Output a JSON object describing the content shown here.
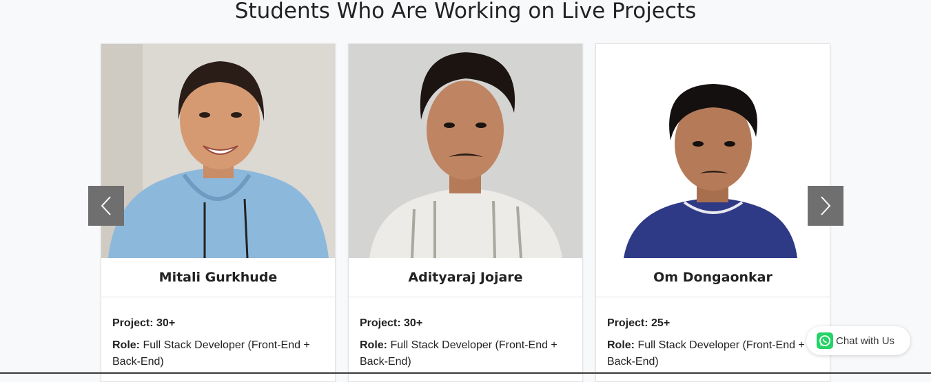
{
  "section": {
    "title": "Students Who Are Working on Live Projects"
  },
  "carousel": {
    "prev_icon": "chevron-left-icon",
    "next_icon": "chevron-right-icon"
  },
  "students": [
    {
      "name": "Mitali Gurkhude",
      "project_label": "Project:",
      "project_value": "30+",
      "role_label": "Role:",
      "role_value": "Full Stack Developer (Front-End + Back-End)"
    },
    {
      "name": "Adityaraj Jojare",
      "project_label": "Project:",
      "project_value": "30+",
      "role_label": "Role:",
      "role_value": "Full Stack Developer (Front-End + Back-End)"
    },
    {
      "name": "Om Dongaonkar",
      "project_label": "Project:",
      "project_value": "25+",
      "role_label": "Role:",
      "role_value": "Full Stack Developer (Front-End + Back-End)"
    }
  ],
  "chat": {
    "label": "Chat with Us",
    "icon": "whatsapp-icon"
  },
  "colors": {
    "nav_arrow_bg": "#6f6f6f",
    "whatsapp_green": "#25d366",
    "page_bg": "#f8f9fb"
  }
}
